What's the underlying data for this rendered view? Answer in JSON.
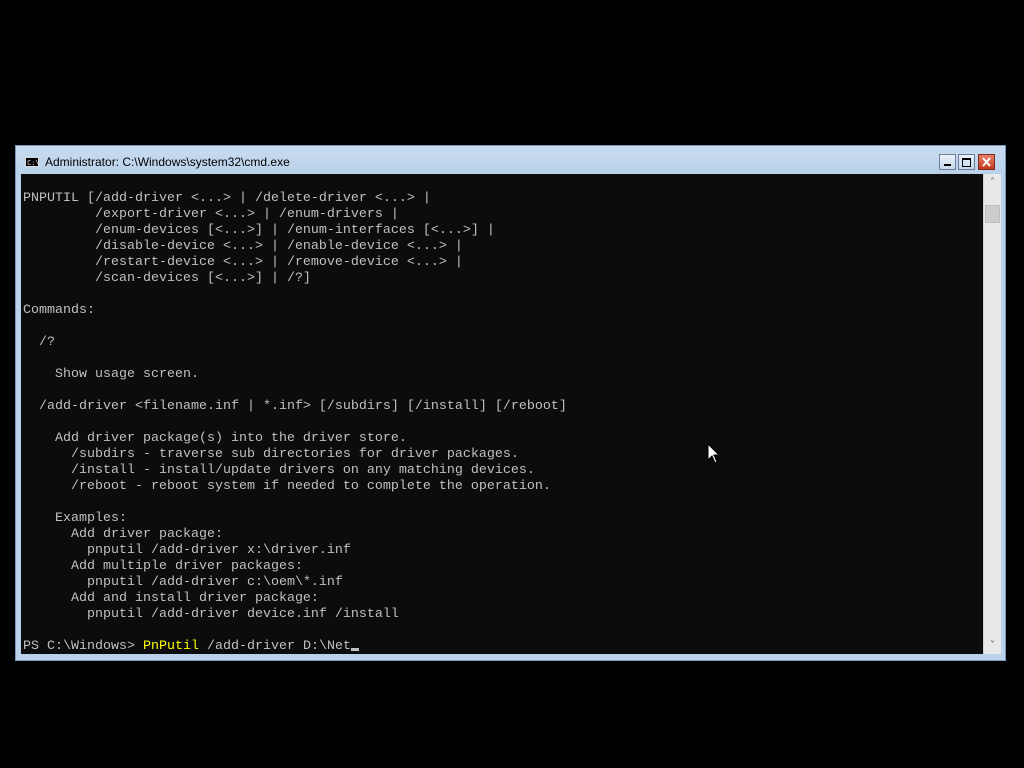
{
  "window": {
    "title": "Administrator: C:\\Windows\\system32\\cmd.exe",
    "icon_label": "C:\\"
  },
  "console": {
    "output_lines": [
      "PNPUTIL [/add-driver <...> | /delete-driver <...> |",
      "         /export-driver <...> | /enum-drivers |",
      "         /enum-devices [<...>] | /enum-interfaces [<...>] |",
      "         /disable-device <...> | /enable-device <...> |",
      "         /restart-device <...> | /remove-device <...> |",
      "         /scan-devices [<...>] | /?]",
      "",
      "Commands:",
      "",
      "  /?",
      "",
      "    Show usage screen.",
      "",
      "  /add-driver <filename.inf | *.inf> [/subdirs] [/install] [/reboot]",
      "",
      "    Add driver package(s) into the driver store.",
      "      /subdirs - traverse sub directories for driver packages.",
      "      /install - install/update drivers on any matching devices.",
      "      /reboot - reboot system if needed to complete the operation.",
      "",
      "    Examples:",
      "      Add driver package:",
      "        pnputil /add-driver x:\\driver.inf",
      "      Add multiple driver packages:",
      "        pnputil /add-driver c:\\oem\\*.inf",
      "      Add and install driver package:",
      "        pnputil /add-driver device.inf /install"
    ],
    "prompt": "PS C:\\Windows> ",
    "command_name": "PnPutil",
    "command_args": " /add-driver D:\\Net"
  },
  "colors": {
    "console_background": "#0c0c0c",
    "console_text": "#c0c0c0",
    "command_highlight": "#ffff00",
    "titlebar": "#b9d1ea",
    "close_button": "#c43a1d"
  },
  "icons": {
    "app": "cmd-icon",
    "minimize": "minimize-icon",
    "maximize": "maximize-icon",
    "close": "close-icon",
    "scroll_up": "chevron-up-icon",
    "scroll_down": "chevron-down-icon",
    "pointer": "mouse-pointer-icon"
  }
}
